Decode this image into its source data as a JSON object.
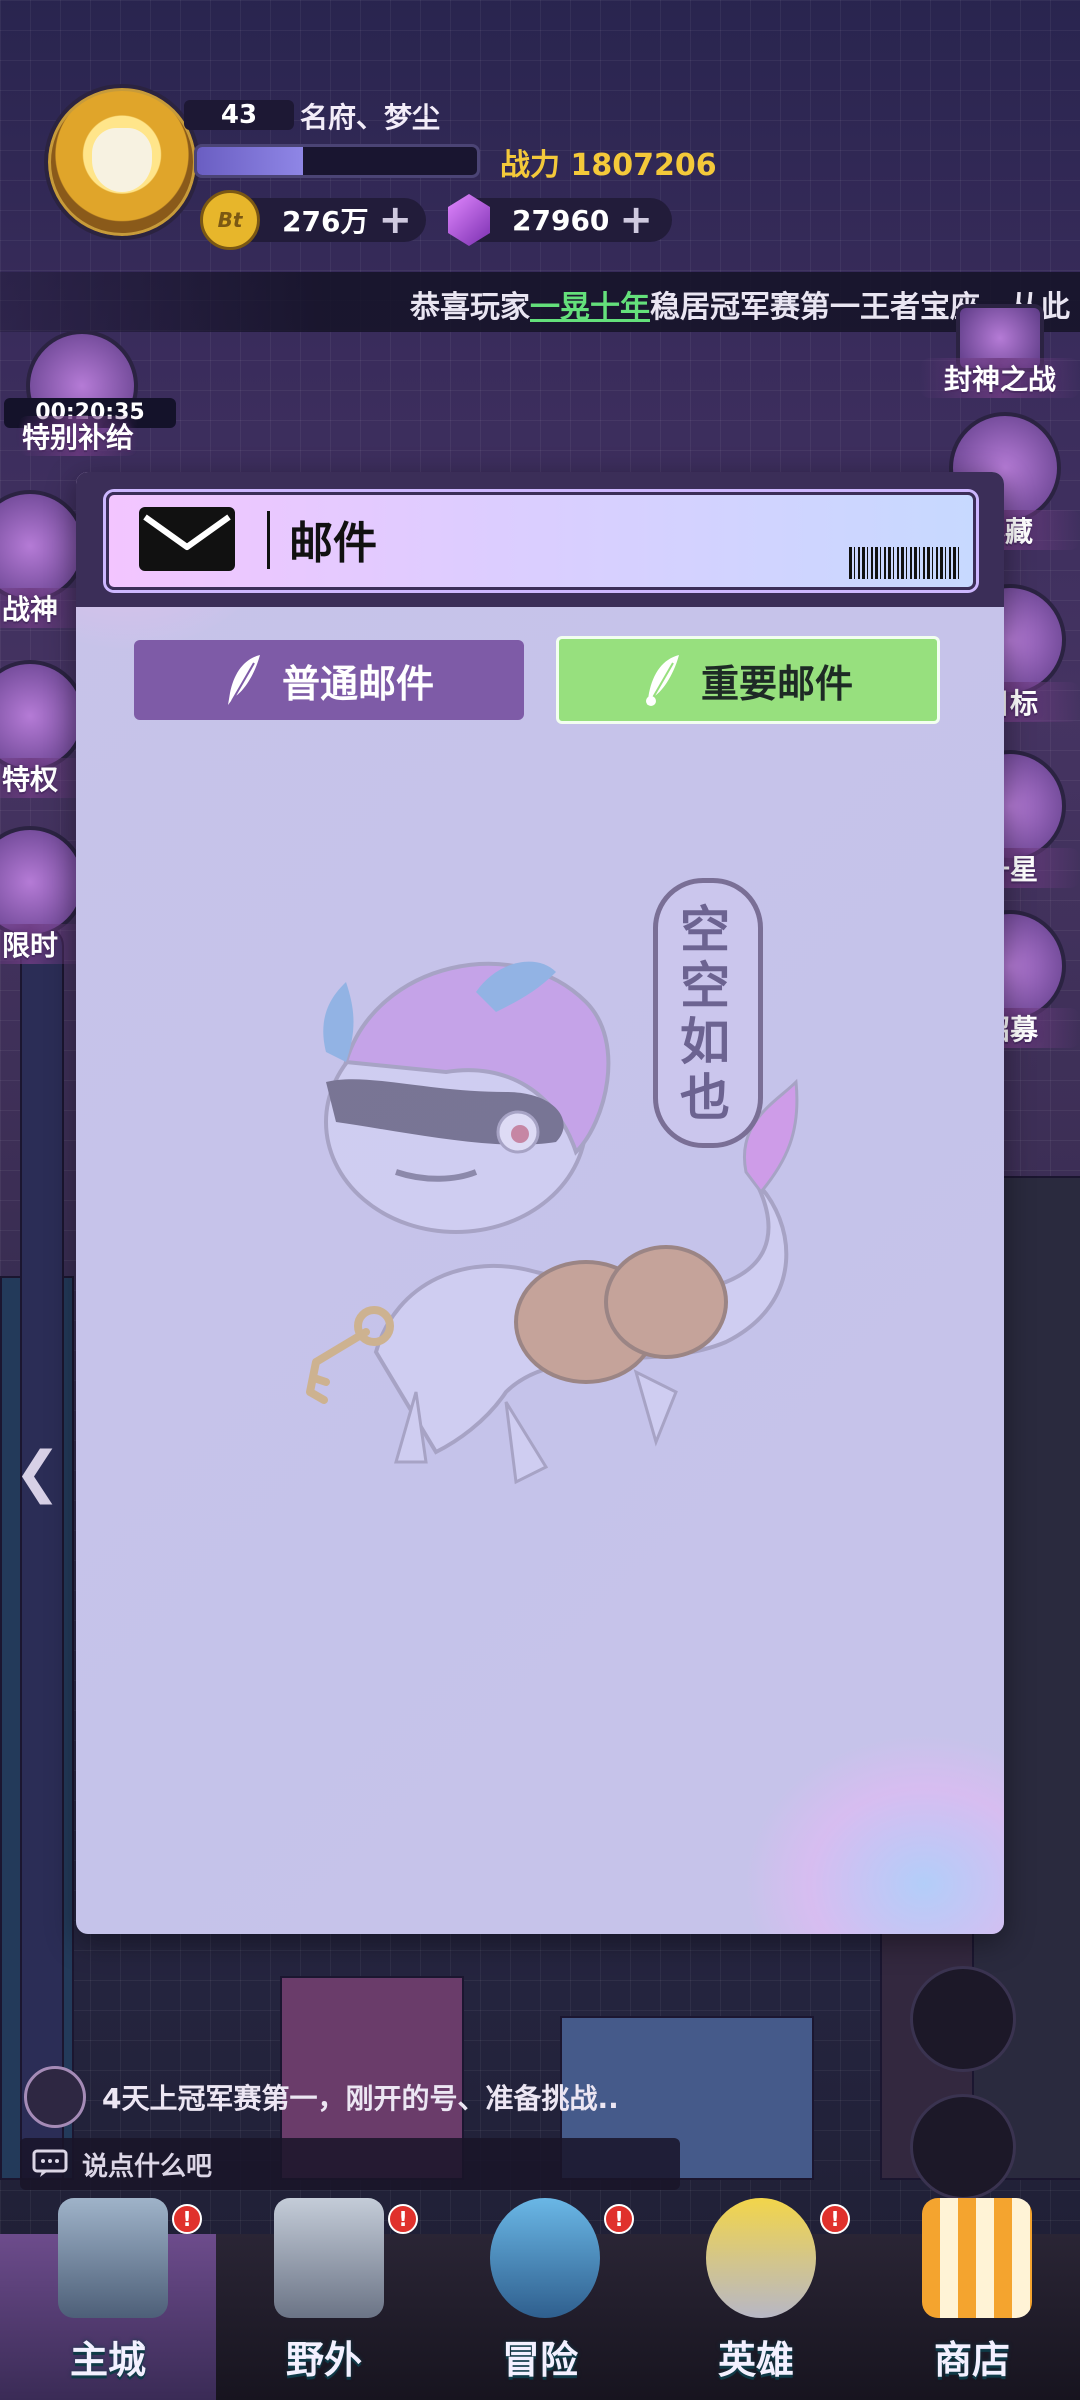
{
  "player": {
    "level": "43",
    "name": "名府、梦尘",
    "xp_fraction": 0.38,
    "power_label": "战力 1807206"
  },
  "resources": {
    "coin_symbol": "Bt",
    "coins": "276万",
    "gems": "27960",
    "plus": "+"
  },
  "ticker": {
    "prefix": "恭喜玩家",
    "player": "一晃十年",
    "suffix": "稳居冠军赛第一王者宝座，从此"
  },
  "left_events": {
    "timer": "00:20:35",
    "items": [
      "特别补给",
      "战神",
      "特权",
      "限时"
    ]
  },
  "right_events": [
    "封神之战",
    "秘藏",
    "目标",
    "升星",
    "招募"
  ],
  "mail": {
    "title": "邮件",
    "tabs": {
      "normal": "普通邮件",
      "important": "重要邮件"
    },
    "active_tab": "important",
    "empty_text": "空空如也"
  },
  "chat": {
    "message": "4天上冠军赛第一，刚开的号、准备挑战..",
    "input_placeholder": "说点什么吧"
  },
  "nav": {
    "items": [
      {
        "label": "主城",
        "badge": "!"
      },
      {
        "label": "野外",
        "badge": "!"
      },
      {
        "label": "冒险",
        "badge": "!"
      },
      {
        "label": "英雄",
        "badge": "!"
      },
      {
        "label": "商店"
      }
    ],
    "active": "主城"
  },
  "colors": {
    "power": "#f4c93a",
    "tab_normal": "#7e5ba7",
    "tab_important": "#97e07e",
    "dialog_bg": "#c5c3ea",
    "ticker_highlight": "#64e07b"
  }
}
